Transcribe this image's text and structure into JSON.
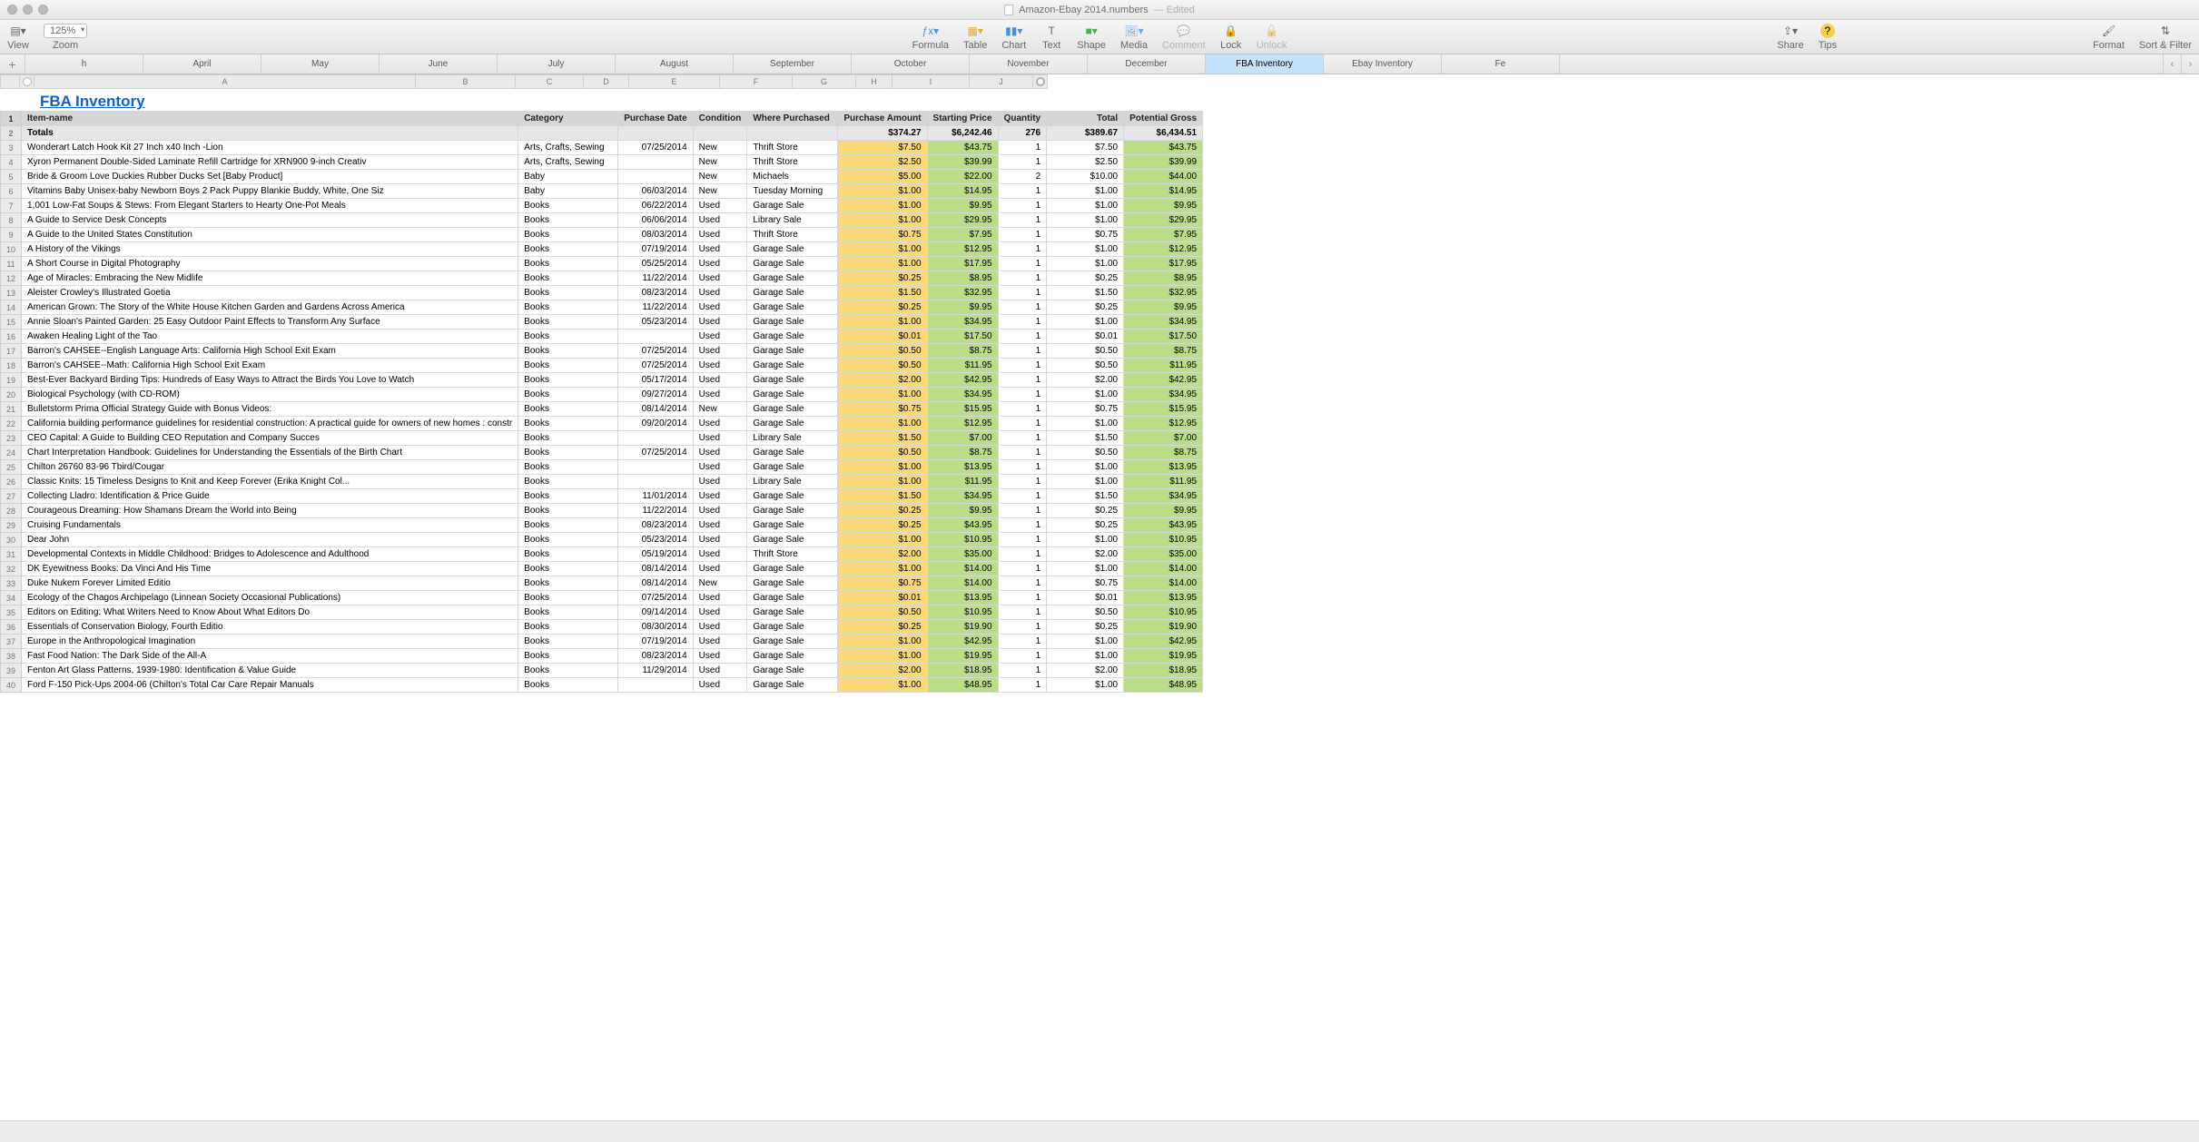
{
  "window": {
    "title": "Amazon-Ebay 2014.numbers",
    "edited": "— Edited"
  },
  "toolbar": {
    "view": "View",
    "zoom": "Zoom",
    "zoom_value": "125%",
    "formula": "Formula",
    "table": "Table",
    "chart": "Chart",
    "text": "Text",
    "shape": "Shape",
    "media": "Media",
    "comment": "Comment",
    "lock": "Lock",
    "unlock": "Unlock",
    "share": "Share",
    "tips": "Tips",
    "format": "Format",
    "sort_filter": "Sort & Filter"
  },
  "tabs": {
    "visible": [
      "h",
      "April",
      "May",
      "June",
      "July",
      "August",
      "September",
      "October",
      "November",
      "December",
      "FBA Inventory",
      "Ebay Inventory",
      "Fe"
    ],
    "active": "FBA Inventory"
  },
  "columns": [
    "A",
    "B",
    "C",
    "D",
    "E",
    "F",
    "G",
    "H",
    "I",
    "J"
  ],
  "table_title": "FBA Inventory",
  "headers": {
    "item_name": "Item-name",
    "category": "Category",
    "purchase_date": "Purchase Date",
    "condition": "Condition",
    "where_purchased": "Where Purchased",
    "purchase_amount": "Purchase Amount",
    "starting_price": "Starting Price",
    "quantity": "Quantity",
    "total": "Total",
    "potential_gross": "Potential Gross"
  },
  "totals": {
    "label": "Totals",
    "purchase_amount": "$374.27",
    "starting_price": "$6,242.46",
    "quantity": "276",
    "total": "$389.67",
    "potential_gross": "$6,434.51"
  },
  "rows": [
    {
      "n": 3,
      "a": "Wonderart Latch Hook Kit 27 Inch x40 Inch -Lion",
      "b": "Arts, Crafts, Sewing",
      "c": "07/25/2014",
      "d": "New",
      "e": "Thrift Store",
      "f": "$7.50",
      "g": "$43.75",
      "h": "1",
      "i": "$7.50",
      "j": "$43.75"
    },
    {
      "n": 4,
      "a": "Xyron Permanent Double-Sided Laminate Refill Cartridge for XRN900 9-inch Creativ",
      "b": "Arts, Crafts, Sewing",
      "c": "",
      "d": "New",
      "e": "Thrift Store",
      "f": "$2.50",
      "g": "$39.99",
      "h": "1",
      "i": "$2.50",
      "j": "$39.99"
    },
    {
      "n": 5,
      "a": "Bride & Groom Love Duckies Rubber Ducks Set [Baby Product]",
      "b": "Baby",
      "c": "",
      "d": "New",
      "e": "Michaels",
      "f": "$5.00",
      "g": "$22.00",
      "h": "2",
      "i": "$10.00",
      "j": "$44.00"
    },
    {
      "n": 6,
      "a": "Vitamins Baby Unisex-baby Newborn Boys 2 Pack Puppy Blankie Buddy, White, One Siz",
      "b": "Baby",
      "c": "06/03/2014",
      "d": "New",
      "e": "Tuesday Morning",
      "f": "$1.00",
      "g": "$14.95",
      "h": "1",
      "i": "$1.00",
      "j": "$14.95"
    },
    {
      "n": 7,
      "a": "1,001 Low-Fat Soups & Stews: From Elegant Starters to Hearty One-Pot Meals",
      "b": "Books",
      "c": "06/22/2014",
      "d": "Used",
      "e": "Garage Sale",
      "f": "$1.00",
      "g": "$9.95",
      "h": "1",
      "i": "$1.00",
      "j": "$9.95"
    },
    {
      "n": 8,
      "a": "A Guide to Service Desk Concepts",
      "b": "Books",
      "c": "06/06/2014",
      "d": "Used",
      "e": "Library Sale",
      "f": "$1.00",
      "g": "$29.95",
      "h": "1",
      "i": "$1.00",
      "j": "$29.95"
    },
    {
      "n": 9,
      "a": "A Guide to the United States Constitution",
      "b": "Books",
      "c": "08/03/2014",
      "d": "Used",
      "e": "Thrift Store",
      "f": "$0.75",
      "g": "$7.95",
      "h": "1",
      "i": "$0.75",
      "j": "$7.95"
    },
    {
      "n": 10,
      "a": "A History of the Vikings",
      "b": "Books",
      "c": "07/19/2014",
      "d": "Used",
      "e": "Garage Sale",
      "f": "$1.00",
      "g": "$12.95",
      "h": "1",
      "i": "$1.00",
      "j": "$12.95"
    },
    {
      "n": 11,
      "a": "A Short Course in Digital Photography",
      "b": "Books",
      "c": "05/25/2014",
      "d": "Used",
      "e": "Garage Sale",
      "f": "$1.00",
      "g": "$17.95",
      "h": "1",
      "i": "$1.00",
      "j": "$17.95"
    },
    {
      "n": 12,
      "a": "Age of Miracles: Embracing the New Midlife",
      "b": "Books",
      "c": "11/22/2014",
      "d": "Used",
      "e": "Garage Sale",
      "f": "$0.25",
      "g": "$8.95",
      "h": "1",
      "i": "$0.25",
      "j": "$8.95"
    },
    {
      "n": 13,
      "a": "Aleister Crowley's Illustrated Goetia",
      "b": "Books",
      "c": "08/23/2014",
      "d": "Used",
      "e": "Garage Sale",
      "f": "$1.50",
      "g": "$32.95",
      "h": "1",
      "i": "$1.50",
      "j": "$32.95"
    },
    {
      "n": 14,
      "a": "American Grown: The Story of the White House Kitchen Garden and Gardens Across America",
      "b": "Books",
      "c": "11/22/2014",
      "d": "Used",
      "e": "Garage Sale",
      "f": "$0.25",
      "g": "$9.95",
      "h": "1",
      "i": "$0.25",
      "j": "$9.95"
    },
    {
      "n": 15,
      "a": "Annie Sloan's Painted Garden: 25 Easy Outdoor Paint Effects to Transform Any Surface",
      "b": "Books",
      "c": "05/23/2014",
      "d": "Used",
      "e": "Garage Sale",
      "f": "$1.00",
      "g": "$34.95",
      "h": "1",
      "i": "$1.00",
      "j": "$34.95"
    },
    {
      "n": 16,
      "a": "Awaken Healing Light of the Tao",
      "b": "Books",
      "c": "",
      "d": "Used",
      "e": "Garage Sale",
      "f": "$0.01",
      "g": "$17.50",
      "h": "1",
      "i": "$0.01",
      "j": "$17.50"
    },
    {
      "n": 17,
      "a": "Barron's CAHSEE--English Language Arts: California High School Exit Exam",
      "b": "Books",
      "c": "07/25/2014",
      "d": "Used",
      "e": "Garage Sale",
      "f": "$0.50",
      "g": "$8.75",
      "h": "1",
      "i": "$0.50",
      "j": "$8.75"
    },
    {
      "n": 18,
      "a": "Barron's CAHSEE--Math: California High School Exit Exam",
      "b": "Books",
      "c": "07/25/2014",
      "d": "Used",
      "e": "Garage Sale",
      "f": "$0.50",
      "g": "$11.95",
      "h": "1",
      "i": "$0.50",
      "j": "$11.95"
    },
    {
      "n": 19,
      "a": "Best-Ever Backyard Birding Tips: Hundreds of Easy Ways to Attract the Birds You Love to Watch",
      "b": "Books",
      "c": "05/17/2014",
      "d": "Used",
      "e": "Garage Sale",
      "f": "$2.00",
      "g": "$42.95",
      "h": "1",
      "i": "$2.00",
      "j": "$42.95"
    },
    {
      "n": 20,
      "a": "Biological Psychology (with CD-ROM)",
      "b": "Books",
      "c": "09/27/2014",
      "d": "Used",
      "e": "Garage Sale",
      "f": "$1.00",
      "g": "$34.95",
      "h": "1",
      "i": "$1.00",
      "j": "$34.95"
    },
    {
      "n": 21,
      "a": "Bulletstorm Prima Official Strategy Guide with Bonus Videos:",
      "b": "Books",
      "c": "08/14/2014",
      "d": "New",
      "e": "Garage Sale",
      "f": "$0.75",
      "g": "$15.95",
      "h": "1",
      "i": "$0.75",
      "j": "$15.95"
    },
    {
      "n": 22,
      "a": "California building performance guidelines for residential construction: A practical guide for owners of new homes : constr",
      "b": "Books",
      "c": "09/20/2014",
      "d": "Used",
      "e": "Garage Sale",
      "f": "$1.00",
      "g": "$12.95",
      "h": "1",
      "i": "$1.00",
      "j": "$12.95"
    },
    {
      "n": 23,
      "a": "CEO Capital: A Guide to Building CEO Reputation and Company Succes",
      "b": "Books",
      "c": "",
      "d": "Used",
      "e": "Library Sale",
      "f": "$1.50",
      "g": "$7.00",
      "h": "1",
      "i": "$1.50",
      "j": "$7.00"
    },
    {
      "n": 24,
      "a": "Chart Interpretation Handbook: Guidelines for Understanding the Essentials of the Birth Chart",
      "b": "Books",
      "c": "07/25/2014",
      "d": "Used",
      "e": "Garage Sale",
      "f": "$0.50",
      "g": "$8.75",
      "h": "1",
      "i": "$0.50",
      "j": "$8.75"
    },
    {
      "n": 25,
      "a": "Chilton 26760 83-96 Tbird/Cougar",
      "b": "Books",
      "c": "",
      "d": "Used",
      "e": "Garage Sale",
      "f": "$1.00",
      "g": "$13.95",
      "h": "1",
      "i": "$1.00",
      "j": "$13.95"
    },
    {
      "n": 26,
      "a": "Classic Knits: 15 Timeless Designs to Knit and Keep Forever (Erika Knight Col...",
      "b": "Books",
      "c": "",
      "d": "Used",
      "e": "Library Sale",
      "f": "$1.00",
      "g": "$11.95",
      "h": "1",
      "i": "$1.00",
      "j": "$11.95"
    },
    {
      "n": 27,
      "a": "Collecting Lladro: Identification & Price Guide",
      "b": "Books",
      "c": "11/01/2014",
      "d": "Used",
      "e": "Garage Sale",
      "f": "$1.50",
      "g": "$34.95",
      "h": "1",
      "i": "$1.50",
      "j": "$34.95"
    },
    {
      "n": 28,
      "a": "Courageous Dreaming: How Shamans Dream the World into Being",
      "b": "Books",
      "c": "11/22/2014",
      "d": "Used",
      "e": "Garage Sale",
      "f": "$0.25",
      "g": "$9.95",
      "h": "1",
      "i": "$0.25",
      "j": "$9.95"
    },
    {
      "n": 29,
      "a": "Cruising Fundamentals",
      "b": "Books",
      "c": "08/23/2014",
      "d": "Used",
      "e": "Garage Sale",
      "f": "$0.25",
      "g": "$43.95",
      "h": "1",
      "i": "$0.25",
      "j": "$43.95"
    },
    {
      "n": 30,
      "a": "Dear John",
      "b": "Books",
      "c": "05/23/2014",
      "d": "Used",
      "e": "Garage Sale",
      "f": "$1.00",
      "g": "$10.95",
      "h": "1",
      "i": "$1.00",
      "j": "$10.95"
    },
    {
      "n": 31,
      "a": "Developmental Contexts in Middle Childhood: Bridges to Adolescence and Adulthood",
      "b": "Books",
      "c": "05/19/2014",
      "d": "Used",
      "e": "Thrift Store",
      "f": "$2.00",
      "g": "$35.00",
      "h": "1",
      "i": "$2.00",
      "j": "$35.00"
    },
    {
      "n": 32,
      "a": "DK Eyewitness Books: Da Vinci And His Time",
      "b": "Books",
      "c": "08/14/2014",
      "d": "Used",
      "e": "Garage Sale",
      "f": "$1.00",
      "g": "$14.00",
      "h": "1",
      "i": "$1.00",
      "j": "$14.00"
    },
    {
      "n": 33,
      "a": "Duke Nukem Forever Limited Editio",
      "b": "Books",
      "c": "08/14/2014",
      "d": "New",
      "e": "Garage Sale",
      "f": "$0.75",
      "g": "$14.00",
      "h": "1",
      "i": "$0.75",
      "j": "$14.00"
    },
    {
      "n": 34,
      "a": "Ecology of the Chagos Archipelago (Linnean Society Occasional Publications)",
      "b": "Books",
      "c": "07/25/2014",
      "d": "Used",
      "e": "Garage Sale",
      "f": "$0.01",
      "g": "$13.95",
      "h": "1",
      "i": "$0.01",
      "j": "$13.95"
    },
    {
      "n": 35,
      "a": "Editors on Editing: What Writers Need to Know About What Editors Do",
      "b": "Books",
      "c": "09/14/2014",
      "d": "Used",
      "e": "Garage Sale",
      "f": "$0.50",
      "g": "$10.95",
      "h": "1",
      "i": "$0.50",
      "j": "$10.95"
    },
    {
      "n": 36,
      "a": "Essentials of Conservation Biology, Fourth Editio",
      "b": "Books",
      "c": "08/30/2014",
      "d": "Used",
      "e": "Garage Sale",
      "f": "$0.25",
      "g": "$19.90",
      "h": "1",
      "i": "$0.25",
      "j": "$19.90"
    },
    {
      "n": 37,
      "a": "Europe in the Anthropological Imagination",
      "b": "Books",
      "c": "07/19/2014",
      "d": "Used",
      "e": "Garage Sale",
      "f": "$1.00",
      "g": "$42.95",
      "h": "1",
      "i": "$1.00",
      "j": "$42.95"
    },
    {
      "n": 38,
      "a": "Fast Food Nation: The Dark Side of the All-A",
      "b": "Books",
      "c": "08/23/2014",
      "d": "Used",
      "e": "Garage Sale",
      "f": "$1.00",
      "g": "$19.95",
      "h": "1",
      "i": "$1.00",
      "j": "$19.95"
    },
    {
      "n": 39,
      "a": "Fenton Art Glass Patterns, 1939-1980: Identification & Value Guide",
      "b": "Books",
      "c": "11/29/2014",
      "d": "Used",
      "e": "Garage Sale",
      "f": "$2.00",
      "g": "$18.95",
      "h": "1",
      "i": "$2.00",
      "j": "$18.95"
    },
    {
      "n": 40,
      "a": "Ford F-150 Pick-Ups 2004-06 (Chilton's Total Car Care Repair Manuals",
      "b": "Books",
      "c": "",
      "d": "Used",
      "e": "Garage Sale",
      "f": "$1.00",
      "g": "$48.95",
      "h": "1",
      "i": "$1.00",
      "j": "$48.95"
    }
  ]
}
